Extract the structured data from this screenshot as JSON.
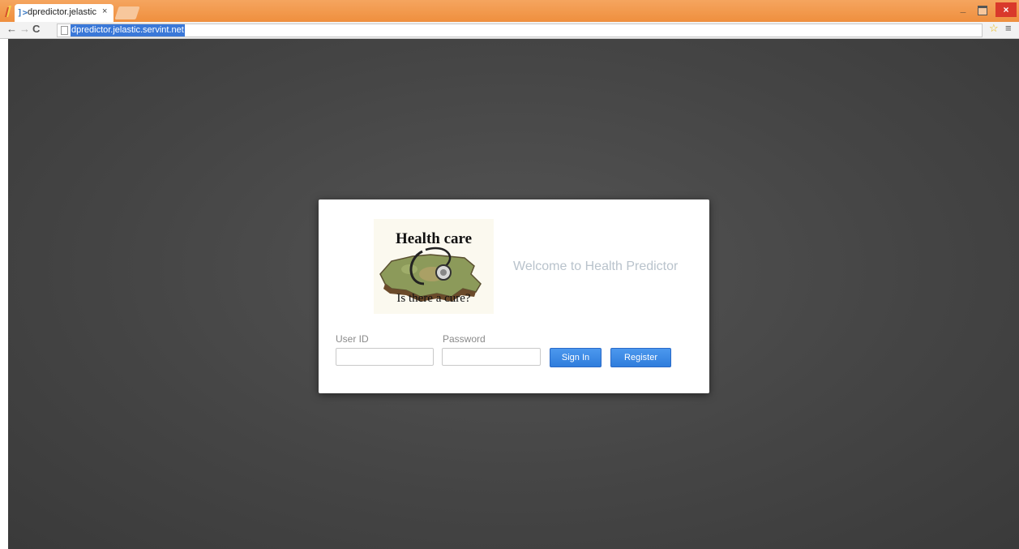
{
  "browser": {
    "tab": {
      "favicon": "]>",
      "title": "dpredictor.jelastic.se",
      "close": "×"
    },
    "window": {
      "minimize": "_",
      "close": "×"
    },
    "nav": {
      "back": "←",
      "forward": "→",
      "reload": "C"
    },
    "url": "dpredictor.jelastic.servint.net",
    "star": "☆",
    "menu": "≡"
  },
  "login": {
    "logo": {
      "top_text": "Health care",
      "bottom_text": "Is there a cure?"
    },
    "welcome": "Welcome to Health Predictor",
    "user_id_label": "User ID",
    "user_id_value": "",
    "password_label": "Password",
    "password_value": "",
    "sign_in": "Sign In",
    "register": "Register"
  },
  "colors": {
    "titlebar": "#ef8f3e",
    "page_bg": "#454545",
    "button": "#2f7ddc",
    "welcome_text": "#b9c3cc"
  }
}
